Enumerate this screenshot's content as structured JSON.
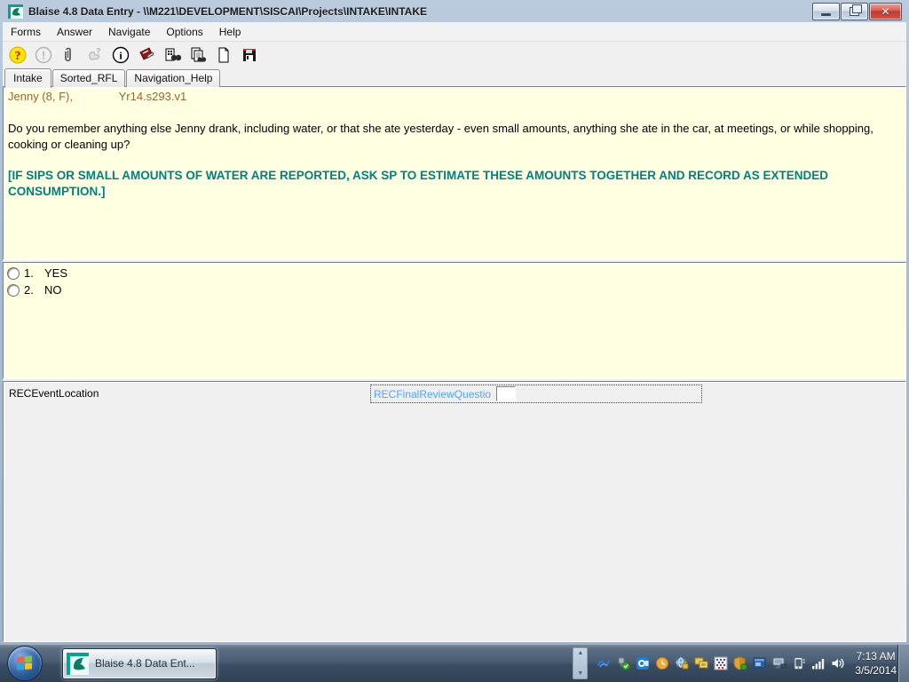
{
  "window": {
    "title": "Blaise 4.8 Data Entry - \\\\M221\\DEVELOPMENT\\SISCAI\\Projects\\INTAKE\\INTAKE",
    "controls": [
      "minimize",
      "restore",
      "close"
    ]
  },
  "menu": {
    "items": [
      "Forms",
      "Answer",
      "Navigate",
      "Options",
      "Help"
    ]
  },
  "toolbar": {
    "icons": [
      "help",
      "error-disabled",
      "remark-paperclip",
      "special-answer-disabled",
      "info",
      "edit-notes",
      "search-form",
      "search-text",
      "new-form",
      "save-form"
    ]
  },
  "tabs": [
    {
      "label": "Intake",
      "active": true
    },
    {
      "label": "Sorted_RFL",
      "active": false
    },
    {
      "label": "Navigation_Help",
      "active": false
    }
  ],
  "question": {
    "header_left": "Jenny (8, F),",
    "header_right": "Yr14.s293.v1",
    "text": "Do you remember anything else Jenny drank, including water, or that she ate yesterday - even small amounts, anything she ate in the car, at meetings, or while shopping, cooking or cleaning up?",
    "instruction": "[IF SIPS OR SMALL AMOUNTS OF WATER ARE REPORTED, ASK SP TO ESTIMATE THESE AMOUNTS TOGETHER AND RECORD AS EXTENDED CONSUMPTION.]"
  },
  "answers": {
    "options": [
      {
        "number": "1.",
        "label": "YES"
      },
      {
        "number": "2.",
        "label": "NO"
      }
    ]
  },
  "form": {
    "left_field_label": "RECEventLocation",
    "active_field_label": "RECFinalReviewQuestio",
    "input_value": ""
  },
  "taskbar": {
    "app_button_label": "Blaise 4.8 Data Ent...",
    "clock_time": "7:13 AM",
    "clock_date": "3/5/2014",
    "tray_icons": [
      "network-activity",
      "usb-safely-remove",
      "outlook",
      "sync-clock",
      "secure-globe",
      "dual-display",
      "remote-grid",
      "security-shield",
      "app-window",
      "network-monitor",
      "mobile-device",
      "signal-strength",
      "volume"
    ]
  },
  "colors": {
    "pane_yellow": "#FFFFE1",
    "instruction_teal": "#008080",
    "active_field_blue": "#4DA6FF",
    "header_brown": "#996633",
    "close_button_red": "#C9514A"
  }
}
